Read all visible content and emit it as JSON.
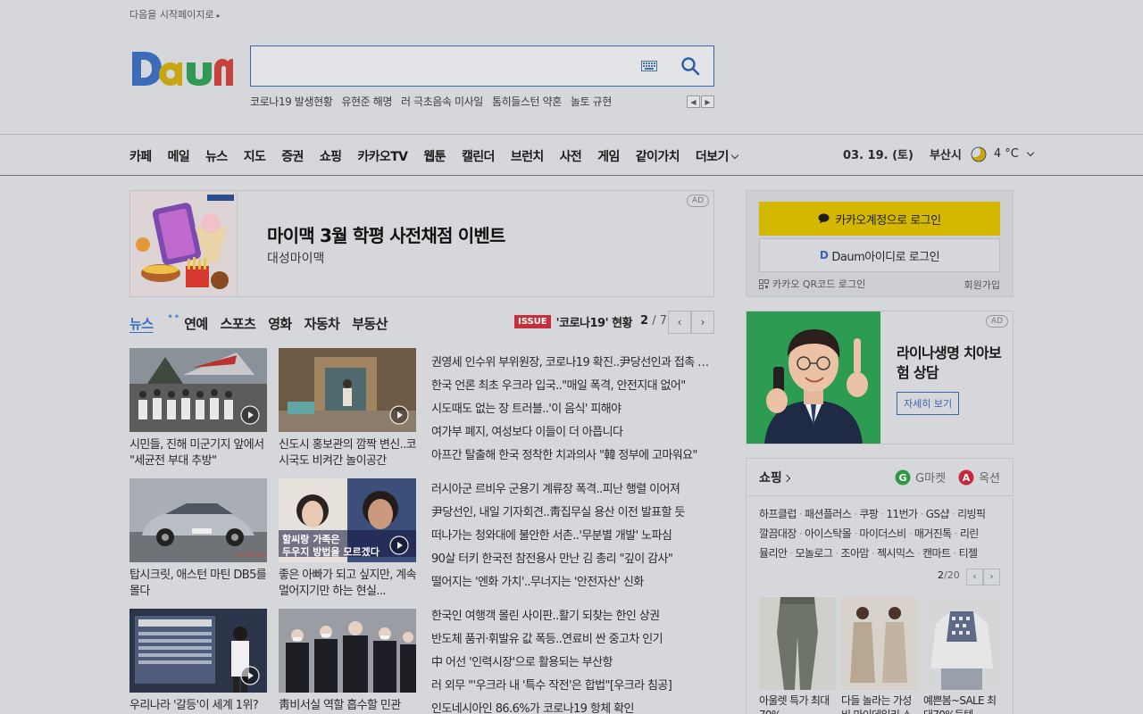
{
  "header": {
    "start_page_link": "다음을 시작페이지로",
    "search_placeholder": "",
    "keywords": [
      "코로나19 발생현황",
      "유현준 해명",
      "러 극초음속 미사일",
      "톰히들스턴 약혼",
      "놀토 규현"
    ]
  },
  "gnb": {
    "items": [
      "카페",
      "메일",
      "뉴스",
      "지도",
      "증권",
      "쇼핑",
      "카카오TV",
      "웹툰",
      "캘린더",
      "브런치",
      "사전",
      "게임",
      "같이가치"
    ],
    "more": "더보기",
    "date": "03. 19. (토)",
    "city": "부산시",
    "temp": "4 °C"
  },
  "ad_banner": {
    "title": "마이맥 3월 학평 사전채점 이벤트",
    "subtitle": "대성마이맥",
    "badge": "AD"
  },
  "news": {
    "tabs": [
      "뉴스",
      "연예",
      "스포츠",
      "영화",
      "자동차",
      "부동산"
    ],
    "issue_badge": "ISSUE",
    "issue_text": "'코로나19' 현황",
    "page_current": "2",
    "page_total": "/ 7",
    "thumbs": [
      {
        "caption": "시민들, 진해 미군기지 앞에서 \"세균전 부대 추방\""
      },
      {
        "caption": "신도시 홍보관의 깜짝 변신..코시국도 비켜간 놀이공간"
      },
      {
        "caption": "탑시크릿, 애스턴 마틴 DB5를 몰다"
      },
      {
        "caption": "좋은 아빠가 되고 싶지만, 계속 멀어지기만 하는 현실..."
      },
      {
        "caption": "우리나라 '갈등'이 세계 1위?"
      },
      {
        "caption": "靑비서실 역할 흡수할 민관"
      }
    ],
    "headline_groups": [
      [
        "권영세 인수위 부위원장, 코로나19 확진..尹당선인과 접촉 없어",
        "한국 언론 최초 우크라 입국..\"매일 폭격, 안전지대 없어\"",
        "시도때도 없는 장 트러블..'이 음식' 피해야",
        "여가부 폐지, 여성보다 이들이 더 아픕니다",
        "아프간 탈출해 한국 정착한 치과의사 \"韓 정부에 고마워요\""
      ],
      [
        "러시아군 르비우 군용기 계류장 폭격..피난 행렬 이어져",
        "尹당선인, 내일 기자회견..靑집무실 용산 이전 발표할 듯",
        "떠나가는 청와대에 불안한 서촌..'무분별 개발' 노파심",
        "90살 터키 한국전 참전용사 만난 김 총리 \"깊이 감사\"",
        "떨어지는 '엔화 가치'..무너지는 '안전자산' 신화"
      ],
      [
        "한국인 여행객 몰린 사이판..활기 되찾는 한인 상권",
        "반도체 품귀·휘발유 값 폭등..연료비 싼 중고차 인기",
        "中 어선 '인력시장'으로 활용되는 부산항",
        "러 외무 \"'우크라 내 '특수 작전'은 합법\"[우크라 침공]",
        "인도네시아인 86.6%가 코로나19 항체 확인"
      ]
    ]
  },
  "login": {
    "kakao_label": "카카오계정으로 로그인",
    "daum_label": "Daum아이디로 로그인",
    "qr_label": "카카오 QR코드 로그인",
    "signup_label": "회원가입"
  },
  "ad2": {
    "title": "라이나생명 치아보험 상담",
    "button": "자세히 보기",
    "badge": "AD"
  },
  "shopping": {
    "title": "쇼핑",
    "partners": [
      "G마켓",
      "옥션"
    ],
    "link_rows": [
      [
        "하프클럽",
        "패션플러스",
        "쿠팡",
        "11번가",
        "GS샵",
        "리빙픽"
      ],
      [
        "깔끔대장",
        "아이스탁몰",
        "마이더스비",
        "매거진톡",
        "리린"
      ],
      [
        "뮬리안",
        "모놀로그",
        "조아맘",
        "젝시믹스",
        "캔마트",
        "티젤"
      ]
    ],
    "page_current": "2",
    "page_total": "/20",
    "items": [
      {
        "text": "아울렛 특가 최대70%"
      },
      {
        "text": "다들 놀라는 가성비 마이데일리 스누"
      },
      {
        "text": "예쁜봄~SALE 최대70%득템"
      }
    ]
  }
}
